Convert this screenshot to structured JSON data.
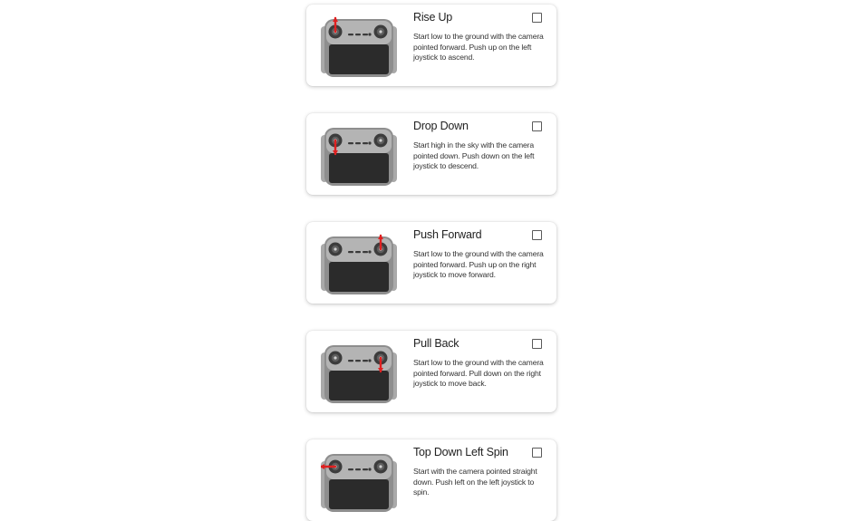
{
  "colors": {
    "accent_arrow": "#e02020",
    "controller_body": "#8e8e8e",
    "controller_screen": "#2b2b2b"
  },
  "icons": {
    "thumbnail": "remote-controller-icon",
    "checkbox": "checkbox-icon"
  },
  "cards": [
    {
      "title": "Rise Up",
      "description": "Start low to the ground with the camera pointed forward. Push up on the left joystick to ascend.",
      "stick": "left",
      "arrow": "up",
      "checked": false
    },
    {
      "title": "Drop Down",
      "description": "Start high in the sky with the camera pointed down. Push down on the left joystick to descend.",
      "stick": "left",
      "arrow": "down",
      "checked": false
    },
    {
      "title": "Push Forward",
      "description": "Start low to the ground with the camera pointed forward. Push up on the right joystick to move forward.",
      "stick": "right",
      "arrow": "up",
      "checked": false
    },
    {
      "title": "Pull Back",
      "description": "Start low to the ground with the camera pointed forward. Pull down on the right joystick to move back.",
      "stick": "right",
      "arrow": "down",
      "checked": false
    },
    {
      "title": "Top Down Left Spin",
      "description": "Start with the camera pointed straight down. Push left on the left joystick to spin.",
      "stick": "left",
      "arrow": "left",
      "checked": false
    }
  ]
}
